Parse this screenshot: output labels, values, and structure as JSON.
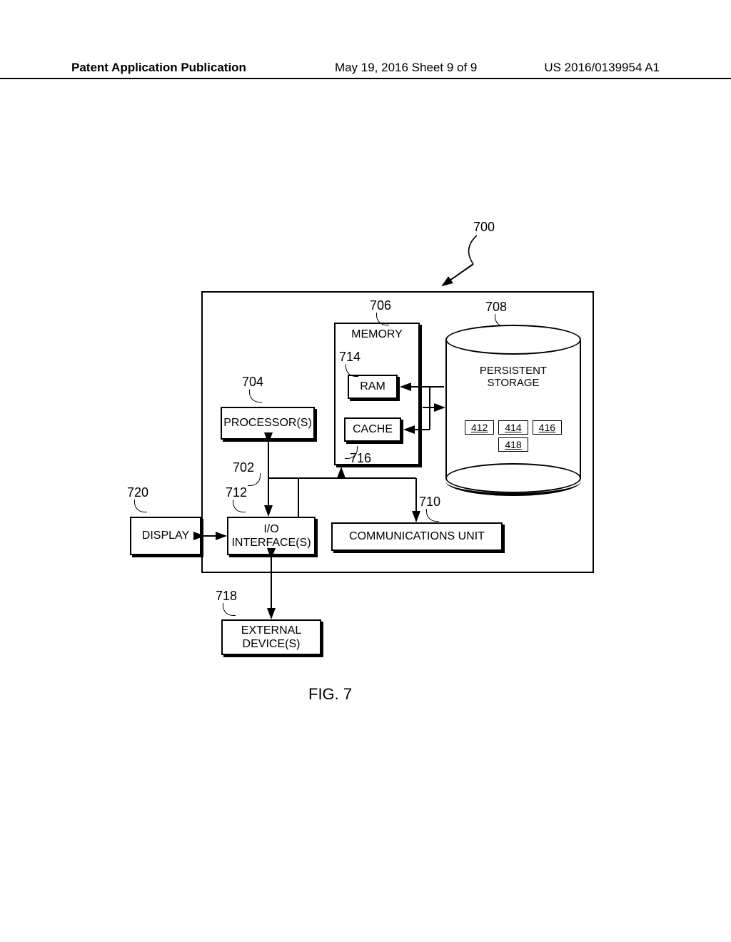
{
  "header": {
    "publication_label": "Patent Application Publication",
    "date_sheet": "May 19, 2016  Sheet 9 of 9",
    "patent_number": "US 2016/0139954 A1"
  },
  "figure": {
    "caption": "FIG. 7"
  },
  "refs": {
    "r700": "700",
    "r702": "702",
    "r704": "704",
    "r706": "706",
    "r708": "708",
    "r710": "710",
    "r712": "712",
    "r714": "714",
    "r716": "716",
    "r718": "718",
    "r720": "720"
  },
  "blocks": {
    "processor": "PROCESSOR(S)",
    "memory": "MEMORY",
    "ram": "RAM",
    "cache": "CACHE",
    "persistent": "PERSISTENT\nSTORAGE",
    "io": "I/O\nINTERFACE(S)",
    "comm": "COMMUNICATIONS UNIT",
    "display": "DISPLAY",
    "external": "EXTERNAL\nDEVICE(S)"
  },
  "storage_slots": [
    "412",
    "414",
    "416",
    "418"
  ]
}
